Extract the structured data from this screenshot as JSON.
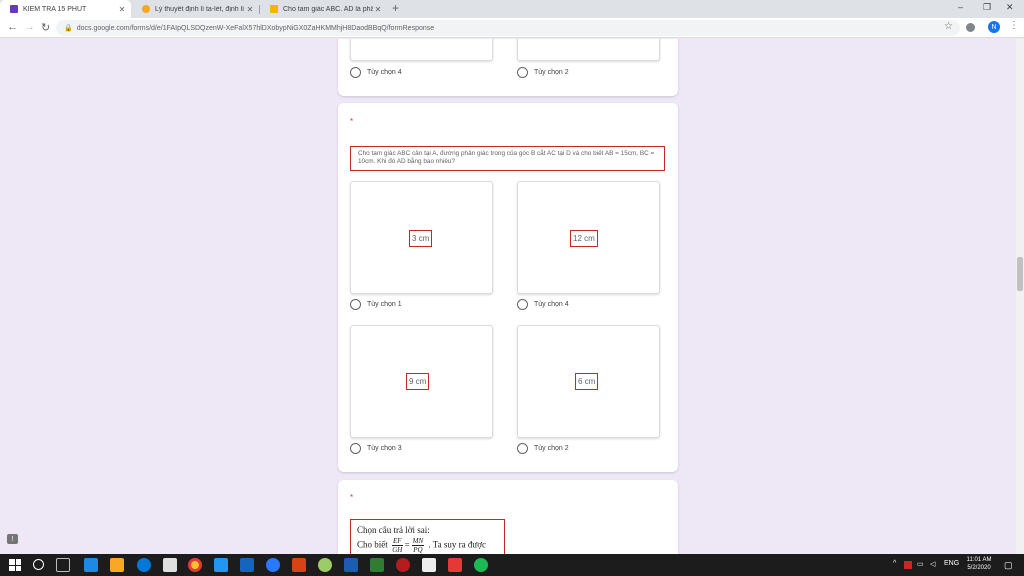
{
  "browser": {
    "tabs": [
      {
        "title": "KIỂM TRA 15 PHÚT",
        "active": true,
        "favicon_color": "#673ab7"
      },
      {
        "title": "Lý thuyết định lí ta-lét, định lí đả",
        "active": false,
        "favicon_color": "#f5a623"
      },
      {
        "title": "Cho tam giác ABC. AD là phân g",
        "active": false,
        "favicon_color": "#f4b400"
      }
    ],
    "new_tab": "+",
    "url": "docs.google.com/forms/d/e/1FAIpQLSDQzenW-XeFalX57hlDXobypNiGX0ZaHKMMhjH8DaodBBqQ/formResponse",
    "profile_initial": "N",
    "window_controls": [
      "–",
      "❐",
      "✕"
    ]
  },
  "form": {
    "q1": {
      "options": [
        {
          "label": "Tùy chọn 4"
        },
        {
          "label": "Tùy chọn 2"
        }
      ]
    },
    "q2": {
      "required_mark": "*",
      "question_text": "Cho tam giác ABC cân tại A, đường phân giác trong của góc B cắt AC tại D và cho biết AB = 15cm, BC = 10cm. Khi đó AD bằng bao nhiêu?",
      "options": [
        {
          "image_text": "3 cm",
          "label": "Tùy chọn 1"
        },
        {
          "image_text": "12 cm",
          "label": "Tùy chọn 4"
        },
        {
          "image_text": "9 cm",
          "label": "Tùy chọn 3"
        },
        {
          "image_text": "6 cm",
          "label": "Tùy chọn 2"
        }
      ]
    },
    "q3": {
      "required_mark": "*",
      "line1": "Chọn câu trả lời sai:",
      "line2_prefix": "Cho biết",
      "frac1": {
        "num": "EF",
        "den": "GH"
      },
      "equals": "=",
      "frac2": {
        "num": "MN",
        "den": "PQ"
      },
      "line2_suffix": ". Ta suy ra được"
    }
  },
  "taskbar": {
    "language": "ENG",
    "time": "11:01 AM",
    "date": "5/2/2020"
  },
  "colors": {
    "page_bg": "#ede7f6",
    "accent": "#673ab7",
    "highlight_border": "#c62828"
  }
}
